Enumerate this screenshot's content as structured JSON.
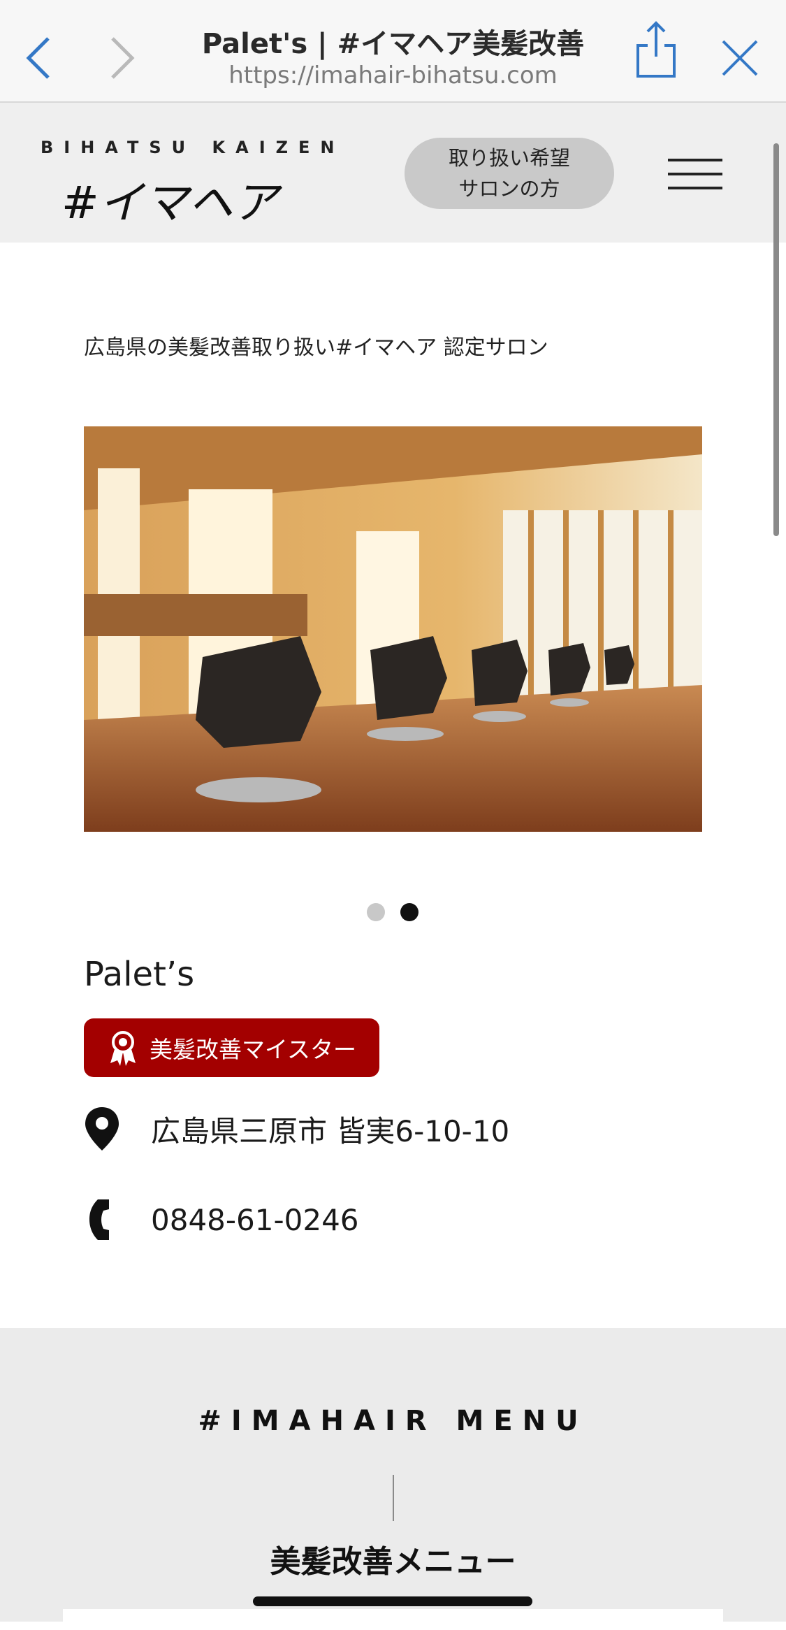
{
  "browser": {
    "title": "Palet's | #イマヘア美髪改善",
    "url": "https://imahair-bihatsu.com"
  },
  "header": {
    "logo_top": "BIHATSU KAIZEN",
    "logo_main": "#イマヘア",
    "salon_button_line1": "取り扱い希望",
    "salon_button_line2": "サロンの方"
  },
  "content": {
    "subtitle": "広島県の美髪改善取り扱い#イマヘア 認定サロン",
    "slider": {
      "current_slide": 2,
      "total_slides": 2
    },
    "salon_name": "Palet’s",
    "badge_label": "美髪改善マイスター",
    "address": "広島県三原市 皆実6-10-10",
    "phone": "0848-61-0246"
  },
  "menu_section": {
    "heading": "#IMAHAIR MENU",
    "subheading": "美髪改善メニュー"
  },
  "colors": {
    "badge": "#a30000",
    "header_bg": "#efefef",
    "menu_bg": "#ebebeb"
  },
  "icons": [
    "chevron-left-icon",
    "chevron-right-icon",
    "share-icon",
    "close-icon",
    "hamburger-icon",
    "award-icon",
    "map-pin-icon",
    "phone-icon"
  ]
}
